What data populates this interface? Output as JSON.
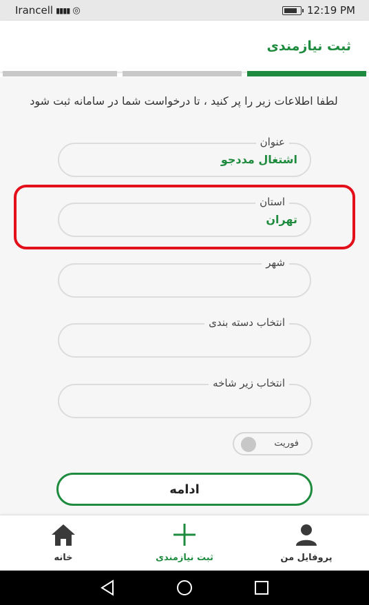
{
  "status_bar": {
    "carrier": "Irancell",
    "time": "12:19 PM"
  },
  "app_bar": {
    "title": "ثبت نیازمندی"
  },
  "steps": {
    "total": 3,
    "active_step": 3,
    "active_color": "#1e8b3e",
    "inactive_color": "#c8c8c8"
  },
  "form": {
    "intro_text": "لطفا اطلاعات زیر را پر کنید ، تا درخواست شما در سامانه ثبت شود",
    "fields": [
      {
        "label": "عنوان",
        "value": "اشتغال مددجو"
      },
      {
        "label": "استان",
        "value": "تهران"
      },
      {
        "label": "شهر",
        "value": ""
      },
      {
        "label": "انتخاب دسته بندی",
        "value": ""
      },
      {
        "label": "انتخاب زیر شاخه",
        "value": ""
      }
    ],
    "urgent_toggle": {
      "label": "فوریت",
      "checked": false
    },
    "continue_label": "ادامه"
  },
  "bottom_nav": {
    "items": [
      {
        "label": "پروفایل من",
        "icon": "person-icon"
      },
      {
        "label": "ثبت نیازمندی",
        "icon": "plus-icon",
        "active": true
      },
      {
        "label": "خانه",
        "icon": "home-icon"
      }
    ]
  },
  "colors": {
    "accent": "#1e8b3e",
    "highlight_border": "#e3101c"
  }
}
